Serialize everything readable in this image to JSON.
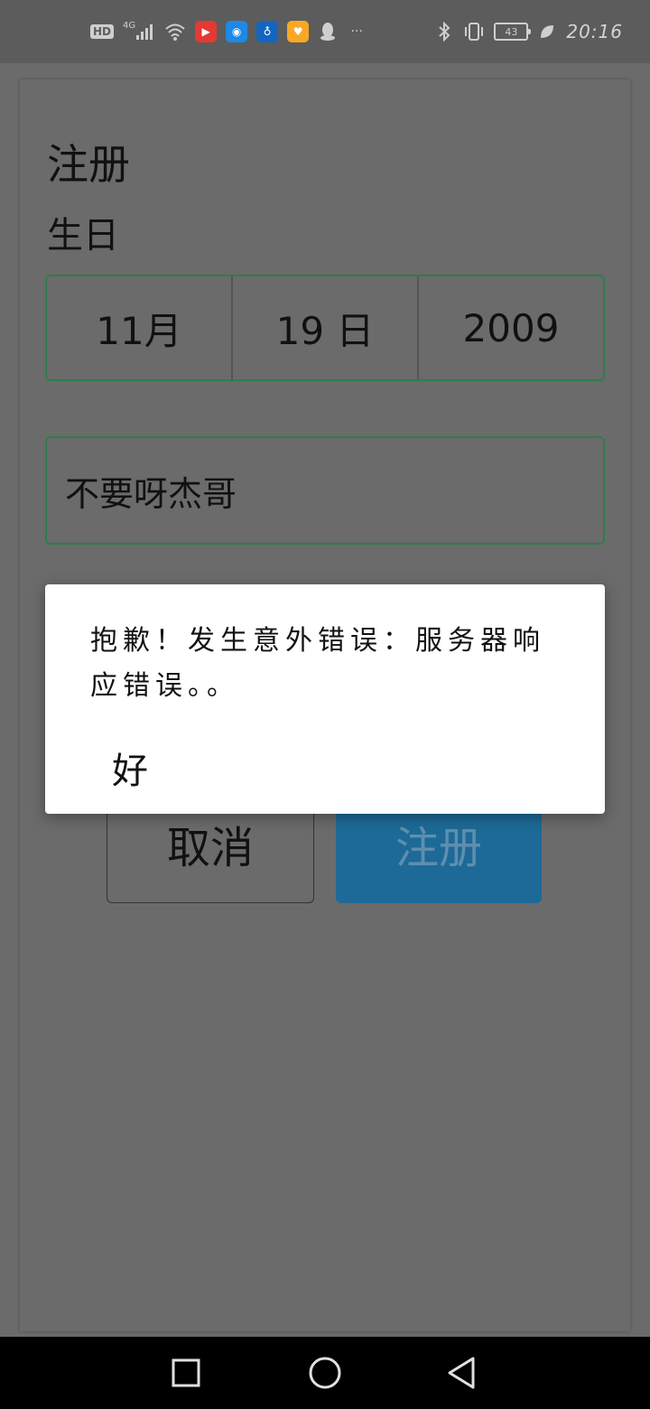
{
  "status_bar": {
    "hd": "HD",
    "network": "4G",
    "time": "20:16",
    "battery": "43",
    "more": "···"
  },
  "form": {
    "title": "注册",
    "birthday_label": "生日",
    "month": "11月",
    "day": "19 日",
    "year": "2009",
    "name_value": "不要呀杰哥",
    "cancel_label": "取消",
    "register_label": "注册"
  },
  "dialog": {
    "message": "抱歉！发生意外错误：服务器响应错误。。",
    "ok_label": "好"
  },
  "colors": {
    "accent_green": "#2e7d4a",
    "register_blue": "#1d6a98",
    "overlay_gray": "#6b6b6b"
  }
}
